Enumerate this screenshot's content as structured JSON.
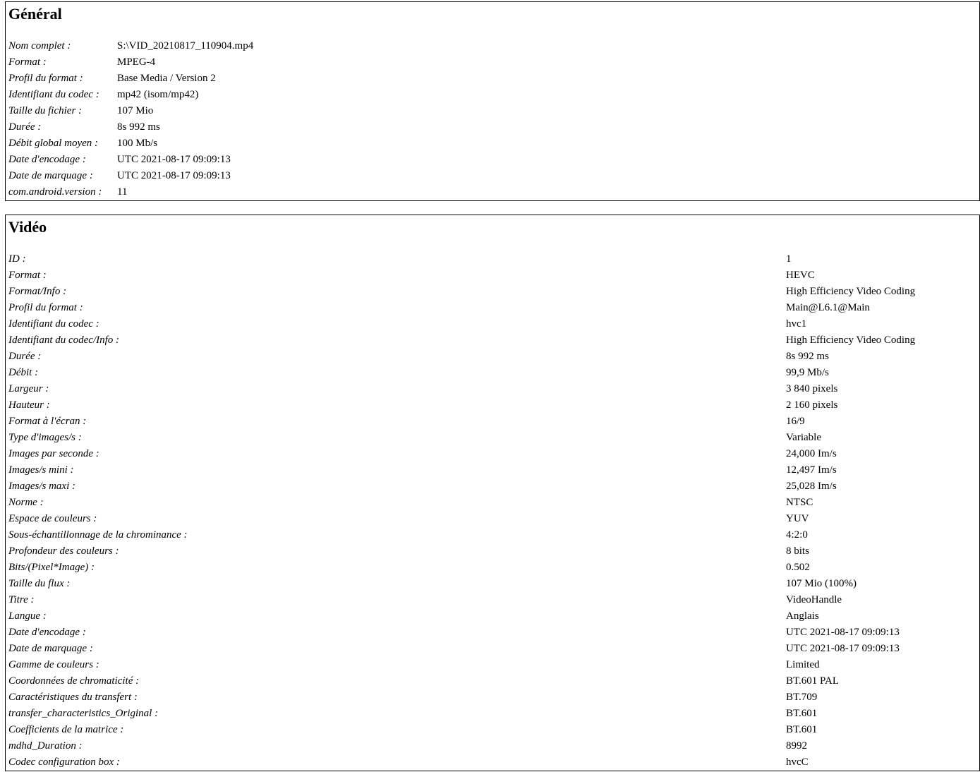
{
  "general": {
    "title": "Général",
    "rows": [
      {
        "label": "Nom complet :",
        "value": "S:\\VID_20210817_110904.mp4"
      },
      {
        "label": "Format :",
        "value": "MPEG-4"
      },
      {
        "label": "Profil du format :",
        "value": "Base Media / Version 2"
      },
      {
        "label": "Identifiant du codec :",
        "value": "mp42 (isom/mp42)"
      },
      {
        "label": "Taille du fichier :",
        "value": "107 Mio"
      },
      {
        "label": "Durée :",
        "value": "8s 992 ms"
      },
      {
        "label": "Débit global moyen :",
        "value": "100 Mb/s"
      },
      {
        "label": "Date d'encodage :",
        "value": "UTC 2021-08-17 09:09:13"
      },
      {
        "label": "Date de marquage :",
        "value": "UTC 2021-08-17 09:09:13"
      },
      {
        "label": "com.android.version :",
        "value": "11"
      }
    ]
  },
  "video": {
    "title": "Vidéo",
    "rows": [
      {
        "label": "ID :",
        "value": "1"
      },
      {
        "label": "Format :",
        "value": "HEVC"
      },
      {
        "label": "Format/Info :",
        "value": "High Efficiency Video Coding"
      },
      {
        "label": "Profil du format :",
        "value": "Main@L6.1@Main"
      },
      {
        "label": "Identifiant du codec :",
        "value": "hvc1"
      },
      {
        "label": "Identifiant du codec/Info :",
        "value": "High Efficiency Video Coding"
      },
      {
        "label": "Durée :",
        "value": "8s 992 ms"
      },
      {
        "label": "Débit :",
        "value": "99,9 Mb/s"
      },
      {
        "label": "Largeur :",
        "value": "3 840 pixels"
      },
      {
        "label": "Hauteur :",
        "value": "2 160 pixels"
      },
      {
        "label": "Format à l'écran :",
        "value": "16/9"
      },
      {
        "label": "Type d'images/s :",
        "value": "Variable"
      },
      {
        "label": "Images par seconde :",
        "value": "24,000 Im/s"
      },
      {
        "label": "Images/s mini :",
        "value": "12,497 Im/s"
      },
      {
        "label": "Images/s maxi :",
        "value": "25,028 Im/s"
      },
      {
        "label": "Norme :",
        "value": "NTSC"
      },
      {
        "label": "Espace de couleurs :",
        "value": "YUV"
      },
      {
        "label": "Sous-échantillonnage de la chrominance :",
        "value": "4:2:0"
      },
      {
        "label": "Profondeur des couleurs :",
        "value": "8 bits"
      },
      {
        "label": "Bits/(Pixel*Image) :",
        "value": "0.502"
      },
      {
        "label": "Taille du flux :",
        "value": "107 Mio (100%)"
      },
      {
        "label": "Titre :",
        "value": "VideoHandle"
      },
      {
        "label": "Langue :",
        "value": "Anglais"
      },
      {
        "label": "Date d'encodage :",
        "value": "UTC 2021-08-17 09:09:13"
      },
      {
        "label": "Date de marquage :",
        "value": "UTC 2021-08-17 09:09:13"
      },
      {
        "label": "Gamme de couleurs :",
        "value": "Limited"
      },
      {
        "label": "Coordonnées de chromaticité :",
        "value": "BT.601 PAL"
      },
      {
        "label": "Caractéristiques du transfert :",
        "value": "BT.709"
      },
      {
        "label": "transfer_characteristics_Original :",
        "value": "BT.601"
      },
      {
        "label": "Coefficients de la matrice :",
        "value": "BT.601"
      },
      {
        "label": "mdhd_Duration :",
        "value": "8992"
      },
      {
        "label": "Codec configuration box :",
        "value": "hvcC"
      }
    ]
  }
}
